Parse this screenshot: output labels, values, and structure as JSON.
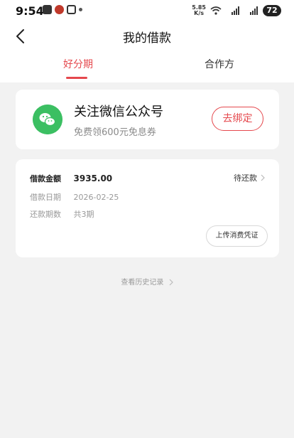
{
  "status_bar": {
    "time": "9:54",
    "net_speed_value": "5.85",
    "net_speed_unit": "K/s",
    "battery": "72",
    "icons": [
      "message-icon",
      "red-app-icon",
      "gallery-icon",
      "dot-icon",
      "wifi-icon",
      "signal-5g-icon",
      "signal-5g-icon"
    ]
  },
  "nav": {
    "title": "我的借款",
    "back_icon": "chevron-left-icon"
  },
  "tabs": [
    {
      "label": "好分期",
      "active": true
    },
    {
      "label": "合作方",
      "active": false
    }
  ],
  "wechat_card": {
    "title": "关注微信公众号",
    "subtitle": "免费领600元免息券",
    "button": "去绑定",
    "icon": "wechat-icon"
  },
  "loan_card": {
    "amount_label": "借款金额",
    "amount": "3935.00",
    "date_label": "借款日期",
    "date": "2026-02-25",
    "periods_label": "还款期数",
    "periods": "共3期",
    "status": "待还款",
    "upload_button": "上传消费凭证"
  },
  "history_link": "查看历史记录",
  "colors": {
    "accent": "#e5484d",
    "wechat": "#3bbf62",
    "background": "#f2f2f2"
  }
}
